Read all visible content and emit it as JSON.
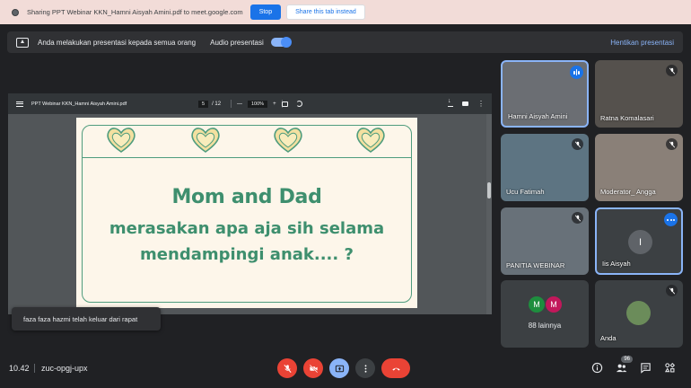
{
  "share_bar": {
    "message": "Sharing PPT Webinar KKN_Hamni Aisyah Amini.pdf to meet.google.com",
    "stop_label": "Stop",
    "share_tab_label": "Share this tab instead"
  },
  "present_bar": {
    "text": "Anda melakukan presentasi kepada semua orang",
    "audio_label": "Audio presentasi",
    "audio_on": true,
    "stop_label": "Hentikan presentasi"
  },
  "pdf": {
    "title": "PPT Webinar KKN_Hamni Aisyah Amini.pdf",
    "page": "5",
    "page_total": "/ 12",
    "zoom_minus": "—",
    "zoom": "100%",
    "zoom_plus": "+",
    "slide_line1": "Mom and Dad",
    "slide_line2": "merasakan apa aja sih selama",
    "slide_line3": "mendampingi anak.... ?"
  },
  "toast": "faza faza hazmi telah keluar dari rapat",
  "participants": [
    {
      "name": "Hamni Aisyah Amini",
      "state": "speaking"
    },
    {
      "name": "Ratna Komalasari",
      "state": "muted"
    },
    {
      "name": "Ucu Fatimah",
      "state": "muted"
    },
    {
      "name": "Moderator_ Angga",
      "state": "muted"
    },
    {
      "name": "PANITIA WEBINAR",
      "state": "muted"
    },
    {
      "name": "Iis Aisyah",
      "initial": "I",
      "state": "more"
    },
    {
      "name": "88 lainnya",
      "initials": [
        "M",
        "M"
      ]
    },
    {
      "name": "Anda",
      "state": "muted"
    }
  ],
  "bottom": {
    "time": "10.42",
    "meeting_code": "zuc-opgj-upx",
    "people_count": "96"
  },
  "colors": {
    "accent": "#8ab4f8",
    "hangup": "#ea4335",
    "slide_green": "#3e8f6e"
  }
}
